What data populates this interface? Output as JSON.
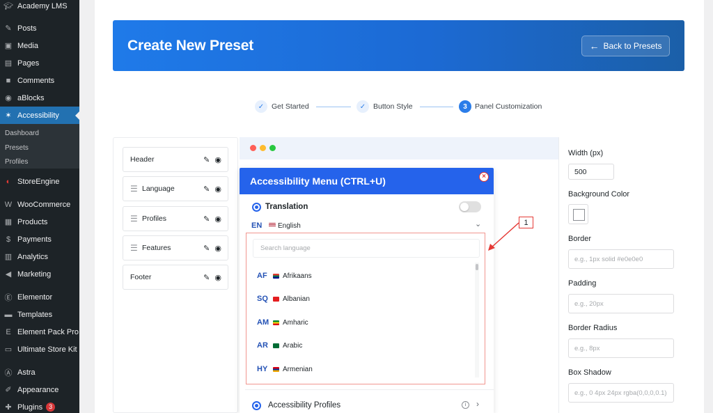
{
  "sidebar": {
    "items": [
      {
        "label": "Academy LMS",
        "icon": "graduation-cap-icon"
      },
      {
        "label": "Posts",
        "icon": "pin-icon"
      },
      {
        "label": "Media",
        "icon": "media-icon"
      },
      {
        "label": "Pages",
        "icon": "pages-icon"
      },
      {
        "label": "Comments",
        "icon": "comments-icon"
      },
      {
        "label": "aBlocks",
        "icon": "ablocks-icon"
      },
      {
        "label": "Accessibility",
        "icon": "accessibility-icon"
      },
      {
        "label": "StoreEngine",
        "icon": "storeengine-icon"
      },
      {
        "label": "WooCommerce",
        "icon": "woocommerce-icon"
      },
      {
        "label": "Products",
        "icon": "products-icon"
      },
      {
        "label": "Payments",
        "icon": "payments-icon"
      },
      {
        "label": "Analytics",
        "icon": "analytics-icon"
      },
      {
        "label": "Marketing",
        "icon": "marketing-icon"
      },
      {
        "label": "Elementor",
        "icon": "elementor-icon"
      },
      {
        "label": "Templates",
        "icon": "templates-icon"
      },
      {
        "label": "Element Pack Pro",
        "icon": "element-pack-icon"
      },
      {
        "label": "Ultimate Store Kit",
        "icon": "store-kit-icon"
      },
      {
        "label": "Astra",
        "icon": "astra-icon"
      },
      {
        "label": "Appearance",
        "icon": "appearance-icon"
      },
      {
        "label": "Plugins",
        "icon": "plugins-icon",
        "badge": "3"
      }
    ],
    "submenu": [
      "Dashboard",
      "Presets",
      "Profiles"
    ]
  },
  "header": {
    "title": "Create New Preset",
    "back_button": "Back to Presets"
  },
  "steps": [
    {
      "label": "Get Started",
      "state": "done",
      "marker": "✓"
    },
    {
      "label": "Button Style",
      "state": "done",
      "marker": "✓"
    },
    {
      "label": "Panel Customization",
      "state": "current",
      "marker": "3"
    }
  ],
  "sections": [
    "Header",
    "Language",
    "Profiles",
    "Features",
    "Footer"
  ],
  "preview": {
    "menu_title": "Accessibility Menu (CTRL+U)",
    "translation_label": "Translation",
    "current_language_code": "EN",
    "current_language": "English",
    "search_placeholder": "Search language",
    "languages": [
      {
        "code": "AF",
        "name": "Afrikaans"
      },
      {
        "code": "SQ",
        "name": "Albanian"
      },
      {
        "code": "AM",
        "name": "Amharic"
      },
      {
        "code": "AR",
        "name": "Arabic"
      },
      {
        "code": "HY",
        "name": "Armenian"
      }
    ],
    "profiles_label": "Accessibility Profiles",
    "callout_number": "1"
  },
  "settings": {
    "width_label": "Width (px)",
    "width_value": "500",
    "bg_color_label": "Background Color",
    "border_label": "Border",
    "border_placeholder": "e.g., 1px solid #e0e0e0",
    "padding_label": "Padding",
    "padding_placeholder": "e.g., 20px",
    "radius_label": "Border Radius",
    "radius_placeholder": "e.g., 8px",
    "shadow_label": "Box Shadow",
    "shadow_placeholder": "e.g., 0 4px 24px rgba(0,0,0,0.1)"
  },
  "colors": {
    "accent": "#2563eb",
    "sidebar_bg": "#1d2327",
    "sidebar_active": "#2271b1",
    "highlight_border": "#f1968f",
    "mac_red": "#ff5f57",
    "mac_yellow": "#febc2e",
    "mac_green": "#28c840"
  }
}
